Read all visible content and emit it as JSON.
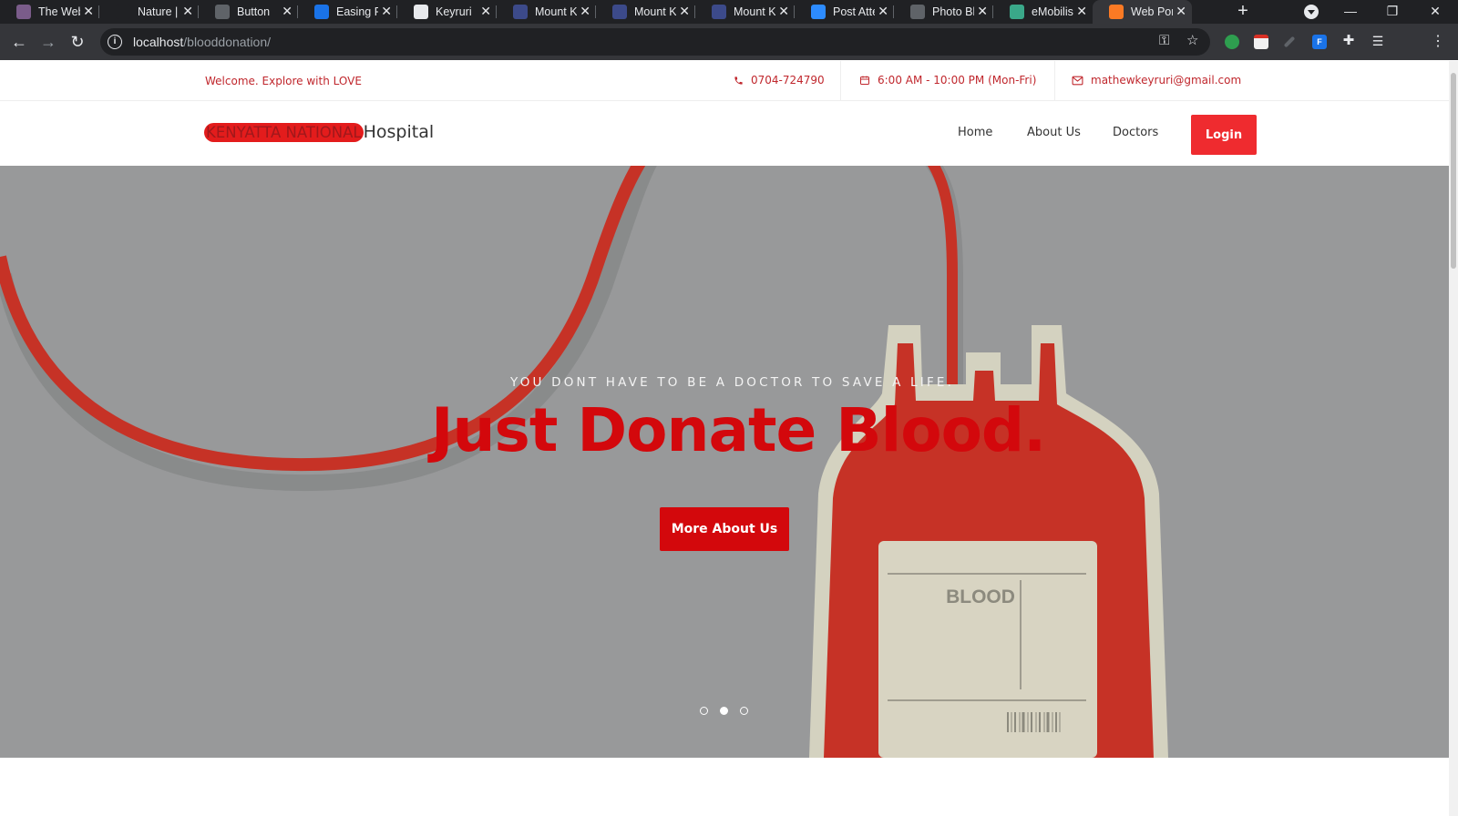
{
  "browser": {
    "tabs": [
      {
        "title": "The Web",
        "icon": "image-favicon",
        "color": "#7a5c8a"
      },
      {
        "title": "Nature |",
        "icon": "blank-favicon",
        "color": "#202124"
      },
      {
        "title": "Button",
        "icon": "globe-favicon",
        "color": "#5f6368"
      },
      {
        "title": "Easing Fu",
        "icon": "e-favicon",
        "color": "#1a73e8"
      },
      {
        "title": "Keyruri",
        "icon": "github-favicon",
        "color": "#e8eaed"
      },
      {
        "title": "Mount K",
        "icon": "school-favicon",
        "color": "#3c4a8a"
      },
      {
        "title": "Mount K",
        "icon": "school-favicon",
        "color": "#3c4a8a"
      },
      {
        "title": "Mount K",
        "icon": "school-favicon",
        "color": "#3c4a8a"
      },
      {
        "title": "Post Atte",
        "icon": "zoom-favicon",
        "color": "#2d8cff"
      },
      {
        "title": "Photo Bl",
        "icon": "globe-favicon",
        "color": "#5f6368"
      },
      {
        "title": "eMobilis",
        "icon": "emobilis-favicon",
        "color": "#3aa889"
      },
      {
        "title": "Web Por",
        "icon": "xampp-favicon",
        "color": "#fb7a24"
      }
    ],
    "active_tab": 11,
    "url_host": "localhost",
    "url_path": "/blooddonation/"
  },
  "topbar": {
    "welcome": "Welcome. Explore with LOVE",
    "phone": "0704-724790",
    "hours": "6:00 AM - 10:00 PM (Mon-Fri)",
    "email": "mathewkeyruri@gmail.com"
  },
  "navbar": {
    "logo_highlight": "KENYATTA NATIONAL",
    "logo_tail": "Hospital",
    "links": [
      "Home",
      "About Us",
      "Doctors"
    ],
    "login": "Login"
  },
  "hero": {
    "subtitle": "YOU DONT HAVE TO BE A DOCTOR TO SAVE A LIFE.",
    "title": "Just Donate Blood.",
    "button": "More About Us",
    "bag_label": "BLOOD",
    "slides": 3,
    "active_slide": 1
  },
  "colors": {
    "brand_red": "#d3080c",
    "login_red": "#ef2b2f",
    "hero_bg": "#98999a"
  }
}
